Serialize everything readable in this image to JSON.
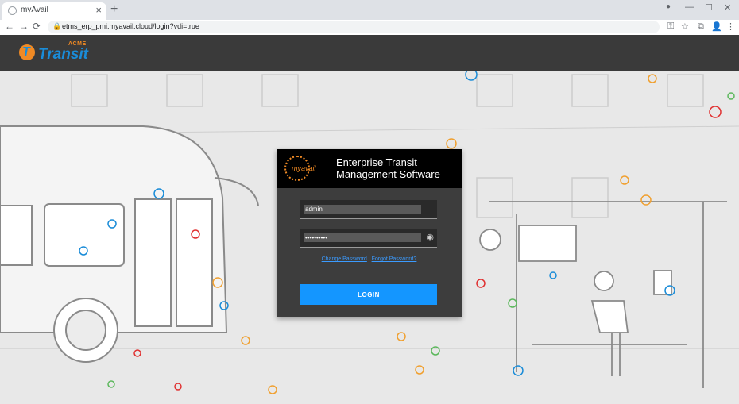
{
  "browser": {
    "tab_title": "myAvail",
    "url": "etms_erp_pmi.myavail.cloud/login?vdi=true",
    "new_tab": "+",
    "tab_close": "×",
    "minimize": "—",
    "maximize": "☐",
    "close": "✕",
    "back": "←",
    "forward": "→",
    "reload": "⟳",
    "lock": "🔒",
    "key": "⚿",
    "star": "☆",
    "extensions": "⧉",
    "profile": "👤",
    "menu": "⋮",
    "record": "●"
  },
  "header": {
    "logo_top": "ACME",
    "logo_brand": "Transit"
  },
  "login": {
    "logo_word": "myavail",
    "title_line1": "Enterprise Transit",
    "title_line2": "Management Software",
    "username_value": "admin",
    "password_value": "••••••••••",
    "show_password_icon": "◉",
    "change_password": "Change Password",
    "separator": "|",
    "forgot_password": "Forgot Password?",
    "login_button": "LOGIN"
  },
  "colors": {
    "accent": "#1496ff",
    "header_bg": "#3a3a3a",
    "card_bg": "#3d3d3d",
    "logo_orange": "#f08a24",
    "logo_blue": "#1a8cd8"
  },
  "icons": [
    "globe-favicon-icon",
    "lock-icon",
    "key-icon",
    "star-icon",
    "puzzle-icon",
    "profile-icon",
    "menu-dots-icon",
    "eye-slash-icon",
    "bus-stop-icon"
  ]
}
